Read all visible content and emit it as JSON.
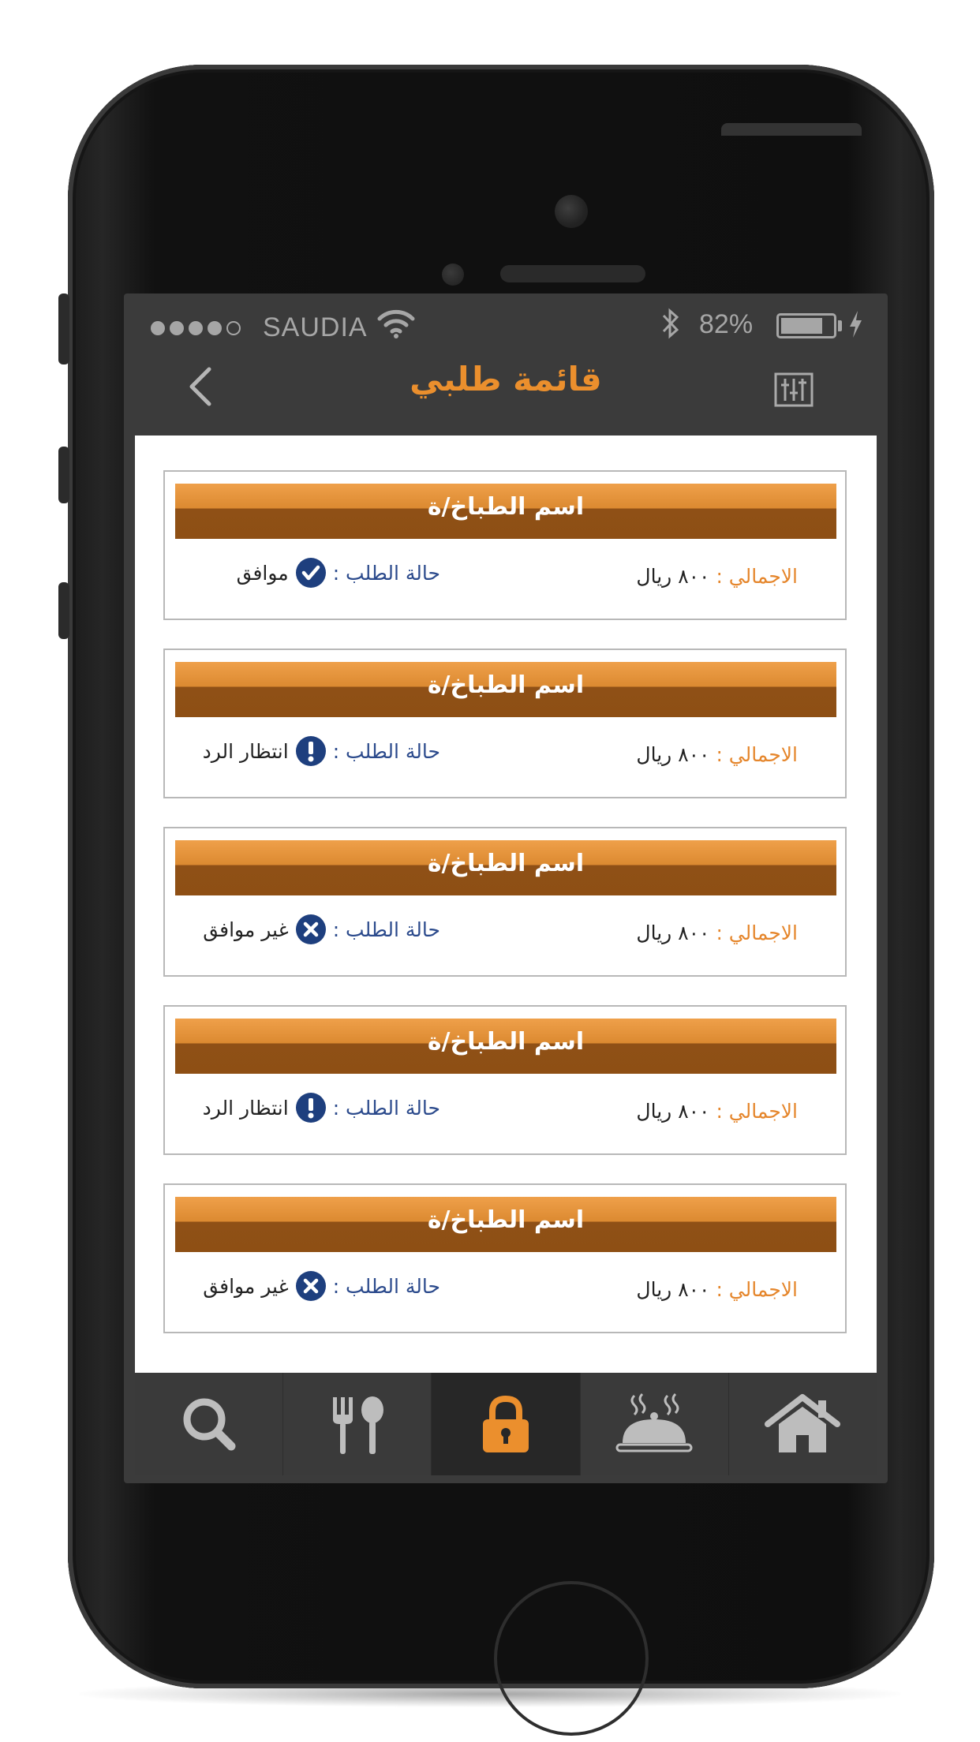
{
  "statusbar": {
    "carrier": "SAUDIA",
    "battery_percent": "82%",
    "battery_level": 0.82
  },
  "nav": {
    "title": "قائمة طلبي",
    "back_icon": "chevron-left-icon",
    "filter_icon": "sliders-icon"
  },
  "orders": [
    {
      "chef": "اسم الطباخ/ة",
      "total_label": "الاجمالي :",
      "total_value": "٨٠٠ ريال",
      "status_label": "حالة الطلب :",
      "status_value": "موافق",
      "status_icon": "check-circle-icon"
    },
    {
      "chef": "اسم الطباخ/ة",
      "total_label": "الاجمالي :",
      "total_value": "٨٠٠ ريال",
      "status_label": "حالة الطلب :",
      "status_value": "انتظار الرد",
      "status_icon": "exclamation-circle-icon"
    },
    {
      "chef": "اسم الطباخ/ة",
      "total_label": "الاجمالي :",
      "total_value": "٨٠٠ ريال",
      "status_label": "حالة الطلب :",
      "status_value": "غير موافق",
      "status_icon": "x-circle-icon"
    },
    {
      "chef": "اسم الطباخ/ة",
      "total_label": "الاجمالي :",
      "total_value": "٨٠٠ ريال",
      "status_label": "حالة الطلب :",
      "status_value": "انتظار الرد",
      "status_icon": "exclamation-circle-icon"
    },
    {
      "chef": "اسم الطباخ/ة",
      "total_label": "الاجمالي :",
      "total_value": "٨٠٠ ريال",
      "status_label": "حالة الطلب :",
      "status_value": "غير موافق",
      "status_icon": "x-circle-icon"
    }
  ],
  "tabbar": {
    "items": [
      {
        "icon": "search-icon",
        "active": false
      },
      {
        "icon": "fork-spoon-icon",
        "active": false
      },
      {
        "icon": "lock-icon",
        "active": true
      },
      {
        "icon": "serving-dish-icon",
        "active": false
      },
      {
        "icon": "home-icon",
        "active": false
      }
    ]
  },
  "colors": {
    "accent": "#eb8f2d",
    "status_blue": "#1e3f7e",
    "bar_bg": "#3b3b3b"
  }
}
